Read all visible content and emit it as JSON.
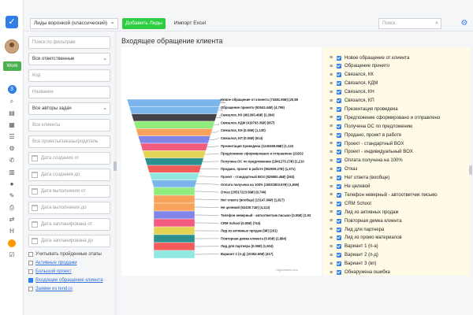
{
  "topbar": {
    "funnel_select": "Лиды воронкой (классический)",
    "add_label": "Добавить Лиды",
    "import_label": "Импорт Excel",
    "search_placeholder": "Поиск"
  },
  "rail": {
    "work_label": "Work",
    "badge_count": "3",
    "letter_h": "H"
  },
  "filters": {
    "search_placeholder": "Поиск по фильтрам",
    "responsible": "Все ответственные",
    "code_placeholder": "Код",
    "name_placeholder": "Название",
    "task_authors": "Все авторы задач",
    "clients_placeholder": "Все клиенты",
    "projects_placeholder": "Все проекты/заказы/родитель",
    "date_created_from": "Дата создания от",
    "date_created_to": "Дата создания до",
    "date_done_from": "Дата выполнения от",
    "date_done_to": "Дата выполнения до",
    "date_planned_from": "Дата запланирована от",
    "date_planned_to": "Дата запланирована до",
    "check_stages": "Учитывать пройденные этапы",
    "links": [
      "Активные продажи",
      "Большой проект",
      "Входящее обращение клиента",
      "Заявки из tend.io"
    ]
  },
  "main": {
    "title": "Входящее обращение клиента"
  },
  "chart_data": {
    "type": "funnel",
    "credit": "Highcharts.com",
    "stages": [
      {
        "label": "Новое обращение от клиента (73481.90₽) (20,85",
        "color": "#7cb5ec"
      },
      {
        "label": "Обращение принято (92643.44₽) (4,759)",
        "color": "#7cb5ec"
      },
      {
        "label": "Связался, КК (491395.40₽) (2,394)",
        "color": "#434348"
      },
      {
        "label": "Связался, КДМ (419793.35₽) (657)",
        "color": "#90ed7d"
      },
      {
        "label": "Связался, КН (0.00₽) (1,130)",
        "color": "#f7a35c"
      },
      {
        "label": "Связался, КП (0.00₽) (614)",
        "color": "#8085e9"
      },
      {
        "label": "Презентация проведена (1240459.86₽) (1,133",
        "color": "#f15c80"
      },
      {
        "label": "Предложение сформировано и отправлено (20202",
        "color": "#e4d354"
      },
      {
        "label": "Получена ОС по предложению (1841275.27₽) (1,210",
        "color": "#2b908f"
      },
      {
        "label": "Продано, проект в работе (552909.27₽) (1,371)",
        "color": "#f45b5b"
      },
      {
        "label": "Проект - стандартный BOX (829800.45₽) (263)",
        "color": "#91e8e1"
      },
      {
        "label": "Оплата получена на 100% (19031803.67₽) (1,559)",
        "color": "#7cb5ec"
      },
      {
        "label": "Отказ (20517223.56₽) (9,749)",
        "color": "#90ed7d"
      },
      {
        "label": "Нет ответа (вообще) (13147.00₽) (1,817)",
        "color": "#f7a35c"
      },
      {
        "label": "Не целевой (62430.71₽) (4,113)",
        "color": "#f7a35c"
      },
      {
        "label": "Телефон неверный - автоответчик письмо (0.00₽) (2,93",
        "color": "#8085e9"
      },
      {
        "label": "CRM School (0.00₽) (744)",
        "color": "#f15c80"
      },
      {
        "label": "Лид из активных продаж (0₽) (261)",
        "color": "#e4d354"
      },
      {
        "label": "Повторная демка клиента (0.00₽) (2,884)",
        "color": "#2b908f"
      },
      {
        "label": "Лид для партнера (0.00₽) (1,504)",
        "color": "#f45b5b"
      },
      {
        "label": "Вариант 2 (п-д) (10362.60₽) (417)",
        "color": "#91e8e1"
      }
    ]
  },
  "legend": {
    "items": [
      "Новое обращение от клиента",
      "Обращение принято",
      "Связался, КК",
      "Связался, КДМ",
      "Связался, КН",
      "Связался, КП",
      "Презентация проведена",
      "Предложение сформировано и отправлено",
      "Получена ОС по предложению",
      "Продано, проект в работе",
      "Проект - стандартный BOX",
      "Проект - индивидуальный BOX",
      "Оплата получена на 100%",
      "Отказ",
      "Нет ответа (вообще)",
      "Не целевой",
      "Телефон неверный - автоответчик письмо",
      "CRM School",
      "Лид из активных продаж",
      "Повторная демка клиента",
      "Лид для партнера",
      "Лид из промо материалов",
      "Вариант 1 (п-а)",
      "Вариант 2 (п-д)",
      "Вариант 3 (вп)",
      "Обнаружена ошибка"
    ]
  }
}
